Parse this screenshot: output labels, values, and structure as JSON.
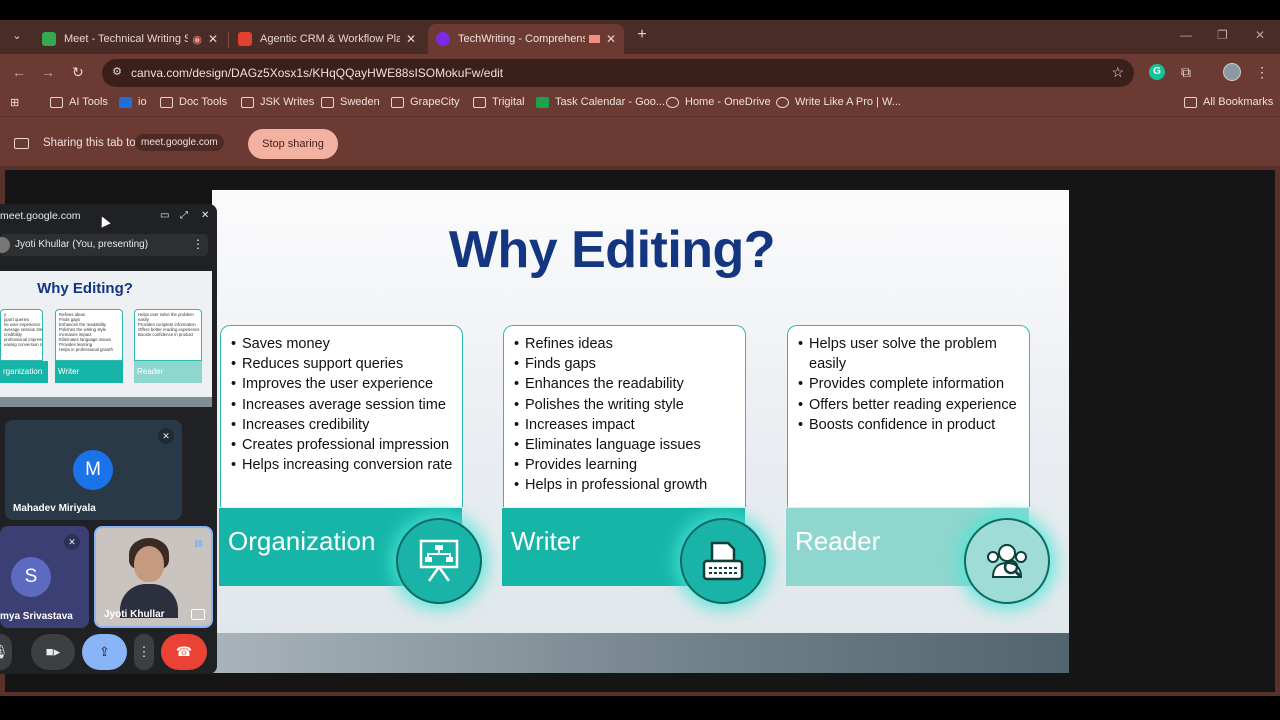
{
  "browser": {
    "tabs": [
      {
        "title": "Meet - Technical Writing Se",
        "favicon_color": "#34a853",
        "status": "recording"
      },
      {
        "title": "Agentic CRM & Workflow Platfo",
        "favicon_color": "#e4402f"
      },
      {
        "title": "TechWriting - Comprehensiv",
        "favicon_color": "#7d2ae8",
        "status": "sharing"
      }
    ],
    "address_url": "canva.com/design/DAGz5Xosx1s/KHqQQayHWE88sISOMokuFw/edit",
    "bookmarks": [
      {
        "label": "AI Tools",
        "icon": "folder-icon"
      },
      {
        "label": "io",
        "icon": "outlook-icon"
      },
      {
        "label": "Doc Tools",
        "icon": "folder-icon"
      },
      {
        "label": "JSK Writes",
        "icon": "folder-icon"
      },
      {
        "label": "Sweden",
        "icon": "folder-icon"
      },
      {
        "label": "GrapeCity",
        "icon": "folder-icon"
      },
      {
        "label": "Trigital",
        "icon": "folder-icon"
      },
      {
        "label": "Task Calendar - Goo...",
        "icon": "sheets-icon"
      },
      {
        "label": "Home - OneDrive",
        "icon": "globe-icon"
      },
      {
        "label": "Write Like A Pro | W...",
        "icon": "globe-icon"
      }
    ],
    "all_bookmarks": "All Bookmarks"
  },
  "sharebar": {
    "text": "Sharing this tab to",
    "target": "meet.google.com",
    "stop_button": "Stop sharing"
  },
  "slide": {
    "title": "Why Editing?",
    "columns": [
      {
        "label": "Organization",
        "icon": "presentation-board-icon",
        "items": [
          "Saves money",
          "Reduces support queries",
          "Improves the user experience",
          "Increases average session time",
          "Increases credibility",
          "Creates professional impression",
          "Helps increasing conversion rate"
        ]
      },
      {
        "label": "Writer",
        "icon": "typewriter-icon",
        "items": [
          "Refines ideas",
          "Finds gaps",
          "Enhances the readability",
          "Polishes the writing style",
          "Increases impact",
          "Eliminates language issues",
          "Provides learning",
          "Helps in professional growth"
        ]
      },
      {
        "label": "Reader",
        "icon": "reader-search-icon",
        "items": [
          "Helps user solve the problem easily",
          "Provides complete information",
          "Offers better reading experience",
          "Boosts confidence in product"
        ]
      }
    ]
  },
  "meet": {
    "host": "meet.google.com",
    "presenter": "Jyoti Khullar (You, presenting)",
    "participants": [
      {
        "initial": "M",
        "name": "Mahadev Miriyala",
        "muted": true,
        "color": "#1a73e8"
      },
      {
        "initial": "S",
        "name": "mya Srivastava",
        "muted": true,
        "color": "#5c6bc0"
      },
      {
        "initial": "",
        "name": "Jyoti Khullar",
        "muted": false,
        "speaking": true
      }
    ],
    "mini_col_text": [
      [
        "y",
        "pport queries",
        "he user experience",
        "average session time",
        "credibility",
        "professional impression",
        "easing conversion rate"
      ],
      [
        "Refines ideas",
        "Finds gaps",
        "Enhances the readability",
        "Polishes the writing style",
        "Increases impact",
        "Eliminates language issues",
        "Provides learning",
        "Helps in professional growth"
      ],
      [
        "Helps user solve the problem",
        "easily",
        "Provides complete information",
        "Offers better reading experience",
        "Boosts confidence in product"
      ]
    ],
    "mini_labels": [
      "rganization",
      "Writer",
      "Reader"
    ]
  }
}
